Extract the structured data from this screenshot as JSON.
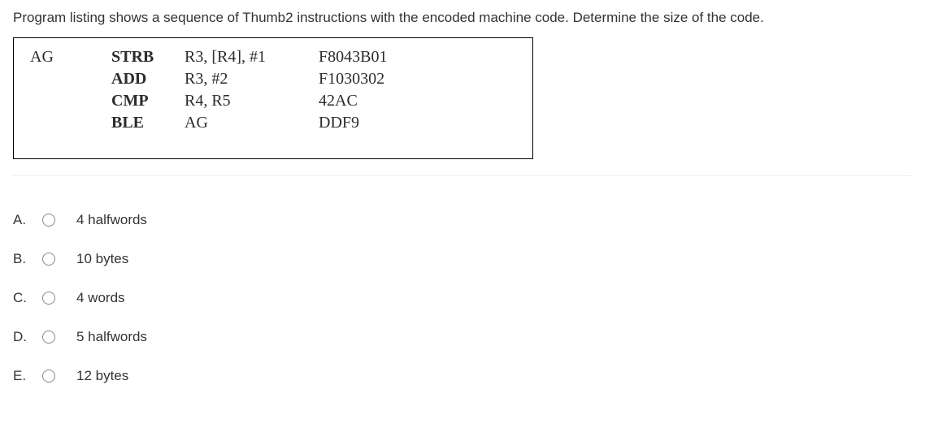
{
  "question": "Program listing shows a sequence of Thumb2 instructions with the encoded machine code. Determine the size of the code.",
  "code": {
    "rows": [
      {
        "label": "AG",
        "mnemonic": "STRB",
        "operands": "R3, [R4], #1",
        "encoding": "F8043B01"
      },
      {
        "label": "",
        "mnemonic": "ADD",
        "operands": "R3, #2",
        "encoding": "F1030302"
      },
      {
        "label": "",
        "mnemonic": "CMP",
        "operands": "R4, R5",
        "encoding": "42AC"
      },
      {
        "label": "",
        "mnemonic": "BLE",
        "operands": "AG",
        "encoding": "DDF9"
      }
    ]
  },
  "options": [
    {
      "letter": "A.",
      "text": "4 halfwords"
    },
    {
      "letter": "B.",
      "text": "10 bytes"
    },
    {
      "letter": "C.",
      "text": "4 words"
    },
    {
      "letter": "D.",
      "text": "5 halfwords"
    },
    {
      "letter": "E.",
      "text": "12 bytes"
    }
  ]
}
